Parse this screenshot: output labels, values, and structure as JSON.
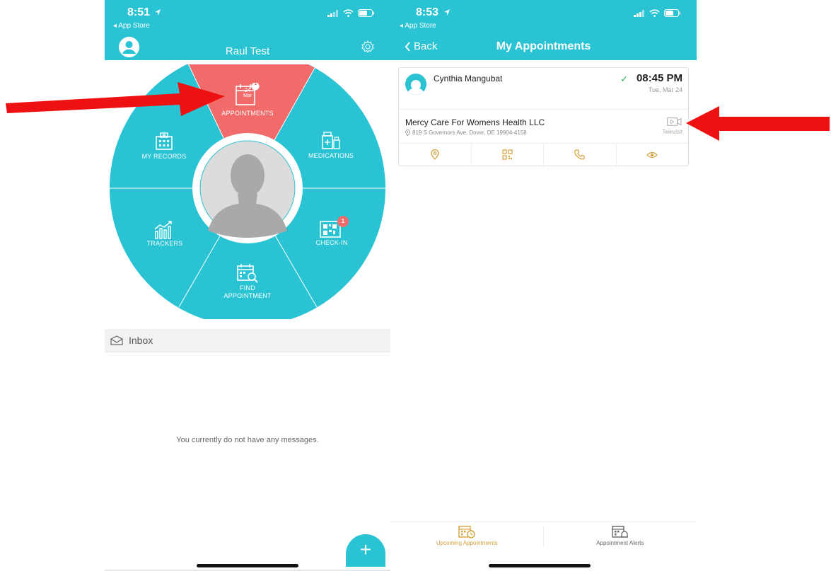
{
  "left": {
    "status": {
      "time": "8:51",
      "back_app": "◂ App Store"
    },
    "header": {
      "title": "Raul Test"
    },
    "wheel": {
      "appointments": {
        "label": "APPOINTMENTS",
        "day": "24",
        "month": "Mar",
        "badge": "1"
      },
      "medications": {
        "label": "MEDICATIONS"
      },
      "check_in": {
        "label": "CHECK-IN",
        "badge": "1"
      },
      "find_appointment": {
        "label_line1": "FIND",
        "label_line2": "APPOINTMENT"
      },
      "trackers": {
        "label": "TRACKERS"
      },
      "my_records": {
        "label": "MY RECORDS"
      }
    },
    "inbox": {
      "label": "Inbox",
      "empty_message": "You currently do not have any messages."
    },
    "fab": {
      "label": "+"
    }
  },
  "right": {
    "status": {
      "time": "8:53",
      "back_app": "◂ App Store"
    },
    "header": {
      "back_label": "Back",
      "title": "My Appointments"
    },
    "appointment": {
      "doctor": "Cynthia Mangubat",
      "time": "08:45 PM",
      "date": "Tue, Mar 24",
      "facility": "Mercy Care For Womens Health LLC",
      "address": "819 S Governors Ave, Dover, DE 19904-4158",
      "visit_type": "Televisit"
    },
    "tabs": [
      {
        "label": "Upcoming Appointments",
        "active": true
      },
      {
        "label": "Appointment Alerts",
        "active": false
      }
    ]
  },
  "colors": {
    "teal": "#29c3d4",
    "coral": "#f26b6b",
    "gold": "#d4a13a",
    "arrow_red": "#ee1111"
  }
}
